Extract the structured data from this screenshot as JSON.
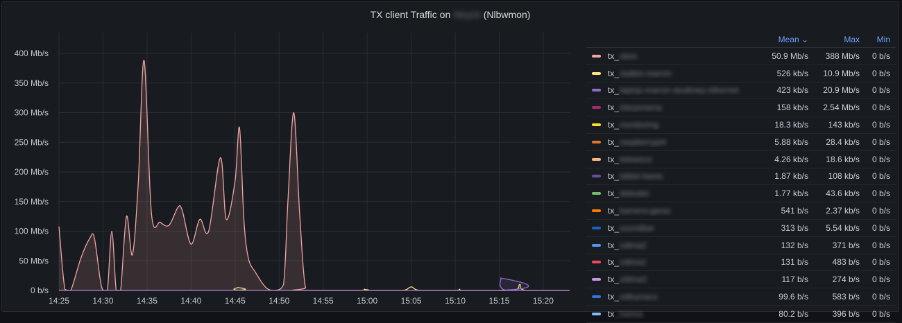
{
  "panel": {
    "title_prefix": "TX client Traffic on",
    "title_hidden": "Strych",
    "title_suffix": "(Nlbwmon)"
  },
  "legend": {
    "headers": {
      "mean": "Mean ⌄",
      "max": "Max",
      "min": "Min"
    },
    "rows": [
      {
        "prefix": "tx_",
        "hidden": "xbox",
        "color": "#f2a4a4",
        "mean": "50.9 Mb/s",
        "max": "388 Mb/s",
        "min": "0 b/s"
      },
      {
        "prefix": "tx_",
        "hidden": "statkin-marcin",
        "color": "#fce086",
        "mean": "526 kb/s",
        "max": "10.9 Mb/s",
        "min": "0 b/s"
      },
      {
        "prefix": "tx_",
        "hidden": "laptop-marcin-studiowy-ethernet",
        "color": "#8f6cc7",
        "mean": "423 kb/s",
        "max": "20.9 Mb/s",
        "min": "0 b/s"
      },
      {
        "prefix": "tx_",
        "hidden": "stacjonarny",
        "color": "#a0296d",
        "mean": "158 kb/s",
        "max": "2.54 Mb/s",
        "min": "0 b/s"
      },
      {
        "prefix": "tx_",
        "hidden": "monitoring",
        "color": "#fade2a",
        "mean": "18.3 kb/s",
        "max": "143 kb/s",
        "min": "0 b/s"
      },
      {
        "prefix": "tx_",
        "hidden": "raspberrypi4",
        "color": "#e0752d",
        "mean": "5.88 kb/s",
        "max": "28.4 kb/s",
        "min": "0 b/s"
      },
      {
        "prefix": "tx_",
        "hidden": "telewizor",
        "color": "#ffb57e",
        "mean": "4.26 kb/s",
        "max": "18.6 kb/s",
        "min": "0 b/s"
      },
      {
        "prefix": "tx_",
        "hidden": "tablet-basia",
        "color": "#6b4e9b",
        "mean": "1.87 kb/s",
        "max": "108 kb/s",
        "min": "0 b/s"
      },
      {
        "prefix": "tx_",
        "hidden": "dekoder",
        "color": "#73bf69",
        "mean": "1.77 kb/s",
        "max": "43.6 kb/s",
        "min": "0 b/s"
      },
      {
        "prefix": "tx_",
        "hidden": "kamera-garaz",
        "color": "#ff780a",
        "mean": "541 b/s",
        "max": "2.37 kb/s",
        "min": "0 b/s"
      },
      {
        "prefix": "tx_",
        "hidden": "soundbar",
        "color": "#1f60c4",
        "mean": "313 b/s",
        "max": "5.54 kb/s",
        "min": "0 b/s"
      },
      {
        "prefix": "tx_",
        "hidden": "zdima2",
        "color": "#5794f2",
        "mean": "132 b/s",
        "max": "371 b/s",
        "min": "0 b/s"
      },
      {
        "prefix": "tx_",
        "hidden": "zdima1",
        "color": "#f2495c",
        "mean": "131 b/s",
        "max": "483 b/s",
        "min": "0 b/s"
      },
      {
        "prefix": "tx_",
        "hidden": "zdima3",
        "color": "#ca95e5",
        "mean": "117 b/s",
        "max": "274 b/s",
        "min": "0 b/s"
      },
      {
        "prefix": "tx_",
        "hidden": "odkurzacz",
        "color": "#3274d9",
        "mean": "99.6 b/s",
        "max": "583 b/s",
        "min": "0 b/s"
      },
      {
        "prefix": "tx",
        "hidden": "_hanna",
        "color": "#8ab8ff",
        "mean": "80.2 b/s",
        "max": "396 b/s",
        "min": "0 b/s"
      }
    ]
  },
  "chart_data": {
    "type": "area",
    "title": "TX client Traffic on (Nlbwmon)",
    "xlabel": "",
    "ylabel": "",
    "unit": "Mb/s",
    "ylim": [
      0,
      400
    ],
    "grid": true,
    "legend_position": "right",
    "x_ticks": [
      "14:25",
      "14:30",
      "14:35",
      "14:40",
      "14:45",
      "14:50",
      "14:55",
      "15:00",
      "15:05",
      "15:10",
      "15:15",
      "15:20"
    ],
    "y_ticks": [
      "0 b/s",
      "50 Mb/s",
      "100 Mb/s",
      "150 Mb/s",
      "200 Mb/s",
      "250 Mb/s",
      "300 Mb/s",
      "350 Mb/s",
      "400 Mb/s"
    ],
    "series": [
      {
        "name": "tx_xbox",
        "color": "#f2a4a4",
        "fill": true,
        "points": [
          [
            "14:25:00",
            108
          ],
          [
            "14:25:40",
            2
          ],
          [
            "14:26:20",
            0
          ],
          [
            "14:27:30",
            55
          ],
          [
            "14:28:30",
            88
          ],
          [
            "14:29:00",
            90
          ],
          [
            "14:29:40",
            20
          ],
          [
            "14:30:00",
            0
          ],
          [
            "14:30:30",
            0
          ],
          [
            "14:31:00",
            100
          ],
          [
            "14:31:30",
            0
          ],
          [
            "14:32:00",
            0
          ],
          [
            "14:32:40",
            125
          ],
          [
            "14:33:20",
            60
          ],
          [
            "14:34:00",
            180
          ],
          [
            "14:34:40",
            388
          ],
          [
            "14:35:30",
            130
          ],
          [
            "14:36:30",
            115
          ],
          [
            "14:37:30",
            110
          ],
          [
            "14:38:30",
            140
          ],
          [
            "14:39:00",
            135
          ],
          [
            "14:40:00",
            78
          ],
          [
            "14:41:00",
            120
          ],
          [
            "14:42:00",
            100
          ],
          [
            "14:43:20",
            224
          ],
          [
            "14:44:00",
            120
          ],
          [
            "14:45:00",
            185
          ],
          [
            "14:45:30",
            275
          ],
          [
            "14:46:00",
            120
          ],
          [
            "14:46:30",
            55
          ],
          [
            "14:47:20",
            30
          ],
          [
            "14:48:30",
            5
          ],
          [
            "14:49:30",
            0
          ],
          [
            "14:50:30",
            10
          ],
          [
            "14:51:00",
            150
          ],
          [
            "14:51:40",
            300
          ],
          [
            "14:52:20",
            130
          ],
          [
            "14:53:00",
            5
          ],
          [
            "14:54:00",
            0
          ],
          [
            "15:23:00",
            0
          ]
        ]
      },
      {
        "name": "tx_statkin-marcin",
        "color": "#fce086",
        "fill": false,
        "points": [
          [
            "14:25:00",
            0
          ],
          [
            "14:44:30",
            0
          ],
          [
            "14:45:20",
            5
          ],
          [
            "14:46:00",
            0
          ],
          [
            "14:59:00",
            0
          ],
          [
            "14:59:40",
            2
          ],
          [
            "15:00:20",
            0
          ],
          [
            "15:04:00",
            0
          ],
          [
            "15:05:00",
            6
          ],
          [
            "15:06:00",
            0
          ],
          [
            "15:10:00",
            0
          ],
          [
            "15:10:30",
            2
          ],
          [
            "15:11:00",
            0
          ],
          [
            "15:16:30",
            0
          ],
          [
            "15:17:20",
            10
          ],
          [
            "15:18:00",
            0
          ],
          [
            "15:23:00",
            0
          ]
        ]
      },
      {
        "name": "tx_laptop-marcin-studiowy-ethernet",
        "color": "#8f6cc7",
        "fill": true,
        "points": [
          [
            "14:25:00",
            0
          ],
          [
            "15:14:30",
            0
          ],
          [
            "15:15:10",
            21
          ],
          [
            "15:15:50",
            0
          ],
          [
            "15:23:00",
            0
          ]
        ]
      }
    ]
  }
}
